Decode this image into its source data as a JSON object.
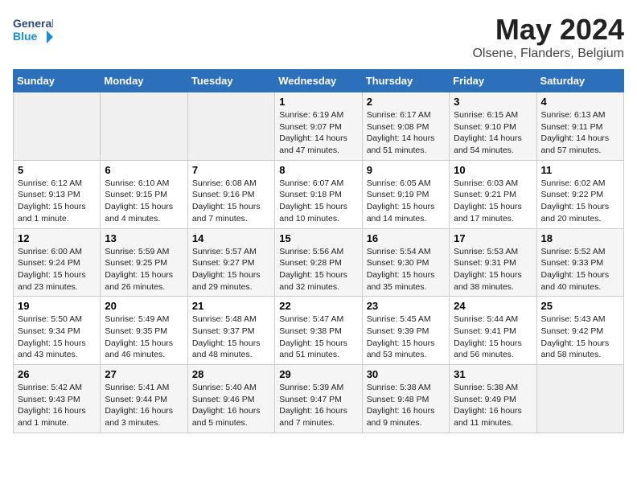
{
  "logo": {
    "line1": "General",
    "line2": "Blue"
  },
  "title": "May 2024",
  "subtitle": "Olsene, Flanders, Belgium",
  "days_header": [
    "Sunday",
    "Monday",
    "Tuesday",
    "Wednesday",
    "Thursday",
    "Friday",
    "Saturday"
  ],
  "weeks": [
    [
      {
        "day": "",
        "info": ""
      },
      {
        "day": "",
        "info": ""
      },
      {
        "day": "",
        "info": ""
      },
      {
        "day": "1",
        "info": "Sunrise: 6:19 AM\nSunset: 9:07 PM\nDaylight: 14 hours\nand 47 minutes."
      },
      {
        "day": "2",
        "info": "Sunrise: 6:17 AM\nSunset: 9:08 PM\nDaylight: 14 hours\nand 51 minutes."
      },
      {
        "day": "3",
        "info": "Sunrise: 6:15 AM\nSunset: 9:10 PM\nDaylight: 14 hours\nand 54 minutes."
      },
      {
        "day": "4",
        "info": "Sunrise: 6:13 AM\nSunset: 9:11 PM\nDaylight: 14 hours\nand 57 minutes."
      }
    ],
    [
      {
        "day": "5",
        "info": "Sunrise: 6:12 AM\nSunset: 9:13 PM\nDaylight: 15 hours\nand 1 minute."
      },
      {
        "day": "6",
        "info": "Sunrise: 6:10 AM\nSunset: 9:15 PM\nDaylight: 15 hours\nand 4 minutes."
      },
      {
        "day": "7",
        "info": "Sunrise: 6:08 AM\nSunset: 9:16 PM\nDaylight: 15 hours\nand 7 minutes."
      },
      {
        "day": "8",
        "info": "Sunrise: 6:07 AM\nSunset: 9:18 PM\nDaylight: 15 hours\nand 10 minutes."
      },
      {
        "day": "9",
        "info": "Sunrise: 6:05 AM\nSunset: 9:19 PM\nDaylight: 15 hours\nand 14 minutes."
      },
      {
        "day": "10",
        "info": "Sunrise: 6:03 AM\nSunset: 9:21 PM\nDaylight: 15 hours\nand 17 minutes."
      },
      {
        "day": "11",
        "info": "Sunrise: 6:02 AM\nSunset: 9:22 PM\nDaylight: 15 hours\nand 20 minutes."
      }
    ],
    [
      {
        "day": "12",
        "info": "Sunrise: 6:00 AM\nSunset: 9:24 PM\nDaylight: 15 hours\nand 23 minutes."
      },
      {
        "day": "13",
        "info": "Sunrise: 5:59 AM\nSunset: 9:25 PM\nDaylight: 15 hours\nand 26 minutes."
      },
      {
        "day": "14",
        "info": "Sunrise: 5:57 AM\nSunset: 9:27 PM\nDaylight: 15 hours\nand 29 minutes."
      },
      {
        "day": "15",
        "info": "Sunrise: 5:56 AM\nSunset: 9:28 PM\nDaylight: 15 hours\nand 32 minutes."
      },
      {
        "day": "16",
        "info": "Sunrise: 5:54 AM\nSunset: 9:30 PM\nDaylight: 15 hours\nand 35 minutes."
      },
      {
        "day": "17",
        "info": "Sunrise: 5:53 AM\nSunset: 9:31 PM\nDaylight: 15 hours\nand 38 minutes."
      },
      {
        "day": "18",
        "info": "Sunrise: 5:52 AM\nSunset: 9:33 PM\nDaylight: 15 hours\nand 40 minutes."
      }
    ],
    [
      {
        "day": "19",
        "info": "Sunrise: 5:50 AM\nSunset: 9:34 PM\nDaylight: 15 hours\nand 43 minutes."
      },
      {
        "day": "20",
        "info": "Sunrise: 5:49 AM\nSunset: 9:35 PM\nDaylight: 15 hours\nand 46 minutes."
      },
      {
        "day": "21",
        "info": "Sunrise: 5:48 AM\nSunset: 9:37 PM\nDaylight: 15 hours\nand 48 minutes."
      },
      {
        "day": "22",
        "info": "Sunrise: 5:47 AM\nSunset: 9:38 PM\nDaylight: 15 hours\nand 51 minutes."
      },
      {
        "day": "23",
        "info": "Sunrise: 5:45 AM\nSunset: 9:39 PM\nDaylight: 15 hours\nand 53 minutes."
      },
      {
        "day": "24",
        "info": "Sunrise: 5:44 AM\nSunset: 9:41 PM\nDaylight: 15 hours\nand 56 minutes."
      },
      {
        "day": "25",
        "info": "Sunrise: 5:43 AM\nSunset: 9:42 PM\nDaylight: 15 hours\nand 58 minutes."
      }
    ],
    [
      {
        "day": "26",
        "info": "Sunrise: 5:42 AM\nSunset: 9:43 PM\nDaylight: 16 hours\nand 1 minute."
      },
      {
        "day": "27",
        "info": "Sunrise: 5:41 AM\nSunset: 9:44 PM\nDaylight: 16 hours\nand 3 minutes."
      },
      {
        "day": "28",
        "info": "Sunrise: 5:40 AM\nSunset: 9:46 PM\nDaylight: 16 hours\nand 5 minutes."
      },
      {
        "day": "29",
        "info": "Sunrise: 5:39 AM\nSunset: 9:47 PM\nDaylight: 16 hours\nand 7 minutes."
      },
      {
        "day": "30",
        "info": "Sunrise: 5:38 AM\nSunset: 9:48 PM\nDaylight: 16 hours\nand 9 minutes."
      },
      {
        "day": "31",
        "info": "Sunrise: 5:38 AM\nSunset: 9:49 PM\nDaylight: 16 hours\nand 11 minutes."
      },
      {
        "day": "",
        "info": ""
      }
    ]
  ]
}
